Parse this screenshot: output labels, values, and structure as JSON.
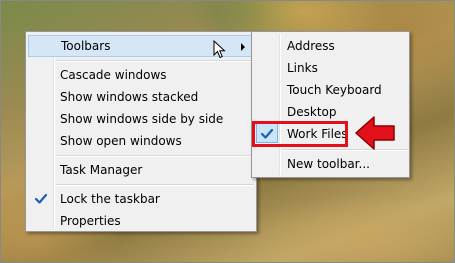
{
  "colors": {
    "menu_bg": "#f0f0f0",
    "hover_bg": "#d5e6f7",
    "hover_border": "#a8cdf1",
    "check_color": "#1a5fb4",
    "annotation_red": "#e3101a"
  },
  "context_menu": {
    "toolbars_label": "Toolbars",
    "cascade_label": "Cascade windows",
    "stacked_label": "Show windows stacked",
    "side_by_side_label": "Show windows side by side",
    "show_open_label": "Show open windows",
    "task_manager_label": "Task Manager",
    "lock_taskbar_label": "Lock the taskbar",
    "lock_taskbar_checked": true,
    "properties_label": "Properties"
  },
  "toolbars_submenu": {
    "items": [
      {
        "label": "Address",
        "checked": false
      },
      {
        "label": "Links",
        "checked": false
      },
      {
        "label": "Touch Keyboard",
        "checked": false
      },
      {
        "label": "Desktop",
        "checked": false
      },
      {
        "label": "Work Files",
        "checked": true
      }
    ],
    "new_toolbar_label": "New toolbar..."
  },
  "icons": {
    "check": "checkmark-icon",
    "submenu_arrow": "chevron-right-icon",
    "cursor": "mouse-pointer-icon",
    "annotation": "red-arrow-icon"
  }
}
